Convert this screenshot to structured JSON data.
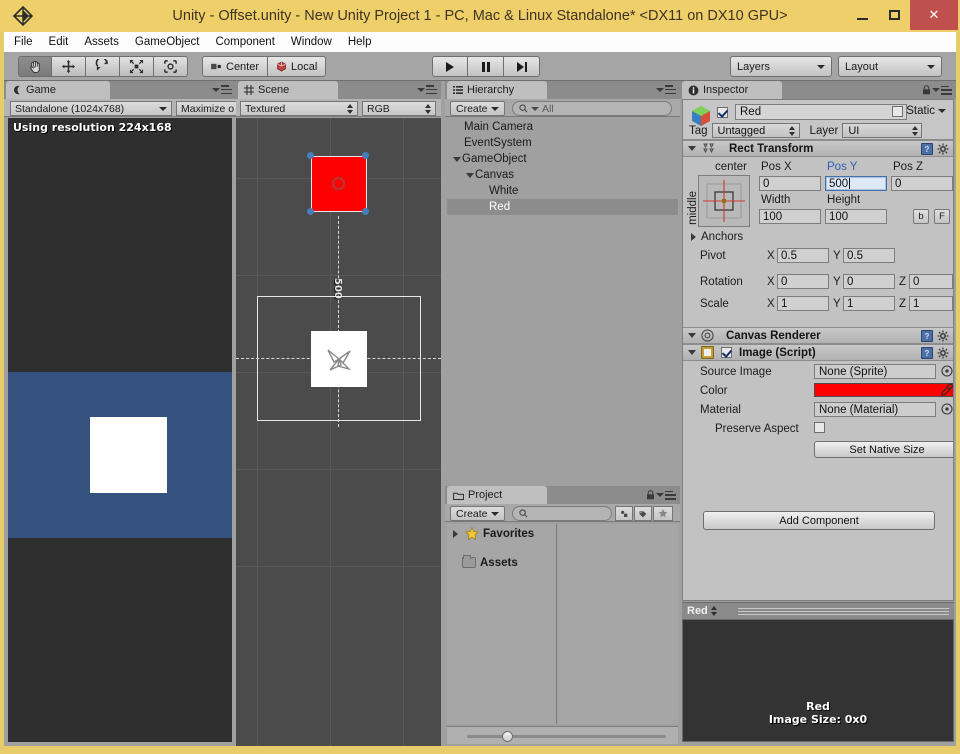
{
  "window": {
    "title": "Unity - Offset.unity - New Unity Project 1 - PC, Mac & Linux Standalone* <DX11 on DX10 GPU>",
    "minimize_label": "–",
    "maximize_label": "□",
    "close_label": "✕"
  },
  "menubar": {
    "items": [
      {
        "label": "File"
      },
      {
        "label": "Edit"
      },
      {
        "label": "Assets"
      },
      {
        "label": "GameObject"
      },
      {
        "label": "Component"
      },
      {
        "label": "Window"
      },
      {
        "label": "Help"
      }
    ]
  },
  "toolbar": {
    "tools": [
      {
        "name": "hand-tool",
        "active": true
      },
      {
        "name": "move-tool",
        "active": false
      },
      {
        "name": "rotate-tool",
        "active": false
      },
      {
        "name": "scale-tool",
        "active": false
      },
      {
        "name": "rect-tool",
        "active": false
      }
    ],
    "pivot_mode": "Center",
    "pivot_rotation": "Local",
    "play": "▶",
    "pause": "‖",
    "step": "▶|",
    "layers": "Layers",
    "layout": "Layout"
  },
  "game_panel": {
    "tab": "Game",
    "aspect": "Standalone (1024x768)",
    "maximize": "Maximize o",
    "resolution_message": "Using resolution 224x168",
    "camera_background_color": "#35527f",
    "white_rect_color": "#ffffff"
  },
  "scene_panel": {
    "tab": "Scene",
    "draw_mode": "Textured",
    "render_mode": "RGB",
    "offset_label": "500",
    "selected_rect_color": "#ff0000",
    "handle_color": "#4a7ebb"
  },
  "hierarchy_panel": {
    "tab": "Hierarchy",
    "create_label": "Create",
    "search_placeholder": "All",
    "items": [
      {
        "label": "Main Camera",
        "depth": 0,
        "foldout": "none",
        "selected": false
      },
      {
        "label": "EventSystem",
        "depth": 0,
        "foldout": "none",
        "selected": false
      },
      {
        "label": "GameObject",
        "depth": 0,
        "foldout": "open",
        "selected": false
      },
      {
        "label": "Canvas",
        "depth": 1,
        "foldout": "open",
        "selected": false
      },
      {
        "label": "White",
        "depth": 2,
        "foldout": "none",
        "selected": false
      },
      {
        "label": "Red",
        "depth": 2,
        "foldout": "none",
        "selected": true
      }
    ]
  },
  "project_panel": {
    "tab": "Project",
    "create_label": "Create",
    "search_placeholder": "",
    "items": [
      {
        "label": "Favorites",
        "icon": "star-icon"
      },
      {
        "label": "Assets",
        "icon": "folder-icon"
      }
    ]
  },
  "inspector": {
    "tab": "Inspector",
    "object_name": "Red",
    "object_enabled": true,
    "static_label": "Static",
    "tag_label": "Tag",
    "tag_value": "Untagged",
    "layer_label": "Layer",
    "layer_value": "UI",
    "rect_transform": {
      "title": "Rect Transform",
      "anchor_preset_horizontal": "center",
      "anchor_preset_vertical": "middle",
      "pos_x_label": "Pos X",
      "pos_x_value": "0",
      "pos_y_label": "Pos Y",
      "pos_y_value": "500",
      "pos_y_focused": true,
      "pos_z_label": "Pos Z",
      "pos_z_value": "0",
      "width_label": "Width",
      "width_value": "100",
      "height_label": "Height",
      "height_value": "100",
      "blueprint_btn": "b",
      "rawedit_btn": "F",
      "anchors_label": "Anchors",
      "pivot_label": "Pivot",
      "pivot_x": "0.5",
      "pivot_y": "0.5",
      "rotation_label": "Rotation",
      "rotation_x": "0",
      "rotation_y": "0",
      "rotation_z": "0",
      "scale_label": "Scale",
      "scale_x": "1",
      "scale_y": "1",
      "scale_z": "1",
      "axis_x": "X",
      "axis_y": "Y",
      "axis_z": "Z"
    },
    "canvas_renderer": {
      "title": "Canvas Renderer"
    },
    "image_script": {
      "title": "Image (Script)",
      "enabled": true,
      "source_image_label": "Source Image",
      "source_image_value": "None (Sprite)",
      "color_label": "Color",
      "color_value": "#ff0000",
      "material_label": "Material",
      "material_value": "None (Material)",
      "preserve_aspect_label": "Preserve Aspect",
      "preserve_aspect_checked": false,
      "set_native_size_label": "Set Native Size"
    },
    "add_component_label": "Add Component",
    "preview": {
      "header": "Red",
      "line1": "Red",
      "line2": "Image Size: 0x0"
    }
  }
}
